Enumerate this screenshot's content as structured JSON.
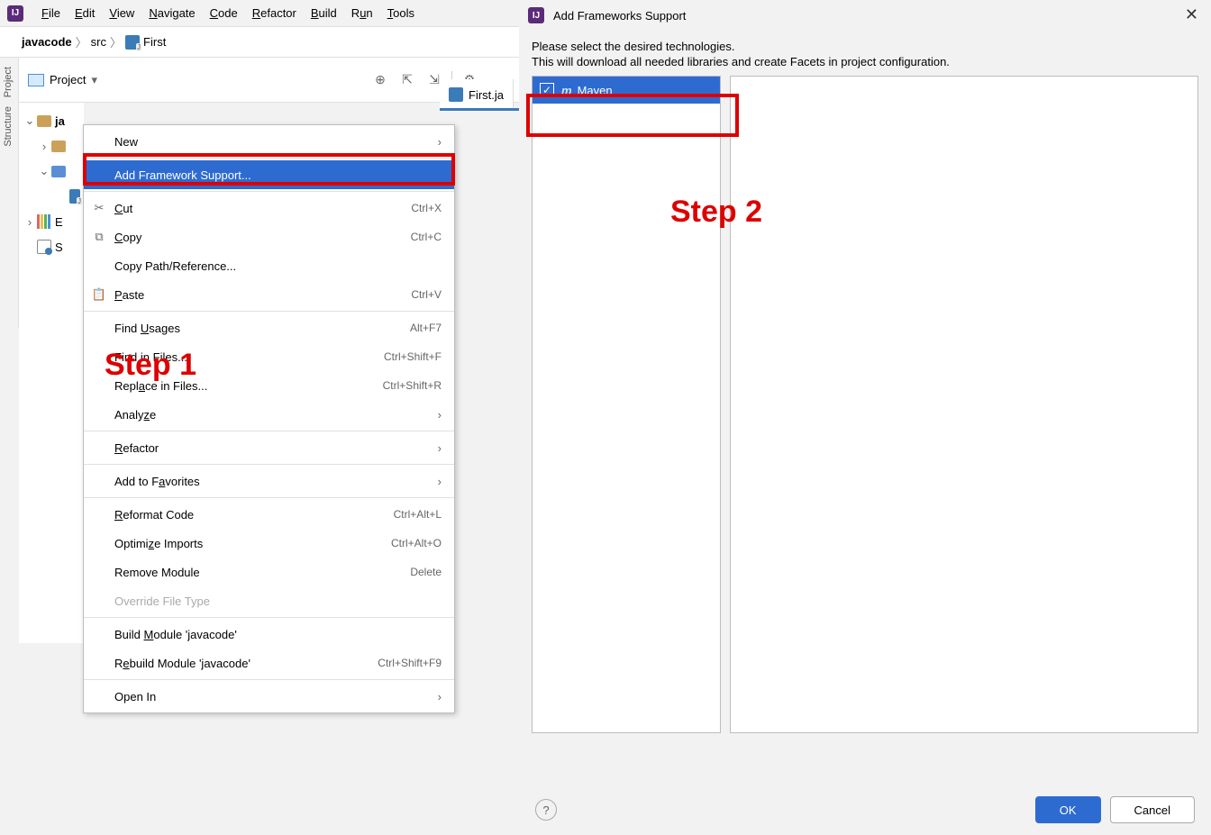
{
  "menubar": [
    "File",
    "Edit",
    "View",
    "Navigate",
    "Code",
    "Refactor",
    "Build",
    "Run",
    "Tools"
  ],
  "breadcrumb": {
    "root": "javacode",
    "mid": "src",
    "leaf": "First"
  },
  "sidetool": {
    "project": "Project",
    "structure": "Structure"
  },
  "projectbar": {
    "label": "Project"
  },
  "tree": {
    "root": "ja",
    "ext": "E",
    "scr": "S"
  },
  "editor": {
    "tab": "First.ja"
  },
  "ctx": {
    "new": "New",
    "addfw": "Add Framework Support...",
    "cut": "Cut",
    "cut_sc": "Ctrl+X",
    "copy": "Copy",
    "copy_sc": "Ctrl+C",
    "copypath": "Copy Path/Reference...",
    "paste": "Paste",
    "paste_sc": "Ctrl+V",
    "findu": "Find Usages",
    "findu_sc": "Alt+F7",
    "findf": "Find in Files...",
    "findf_sc": "Ctrl+Shift+F",
    "repf": "Replace in Files...",
    "repf_sc": "Ctrl+Shift+R",
    "analyze": "Analyze",
    "refactor": "Refactor",
    "fav": "Add to Favorites",
    "refmt": "Reformat Code",
    "refmt_sc": "Ctrl+Alt+L",
    "opt": "Optimize Imports",
    "opt_sc": "Ctrl+Alt+O",
    "rem": "Remove Module",
    "rem_sc": "Delete",
    "ovr": "Override File Type",
    "bld": "Build Module 'javacode'",
    "rbld": "Rebuild Module 'javacode'",
    "rbld_sc": "Ctrl+Shift+F9",
    "open": "Open In"
  },
  "ann": {
    "s1": "Step 1",
    "s2": "Step 2"
  },
  "dlg": {
    "title": "Add Frameworks Support",
    "line1": "Please select the desired technologies.",
    "line2": "This will download all needed libraries and create Facets in project configuration.",
    "tech": "Maven",
    "ok": "OK",
    "cancel": "Cancel",
    "help": "?"
  }
}
